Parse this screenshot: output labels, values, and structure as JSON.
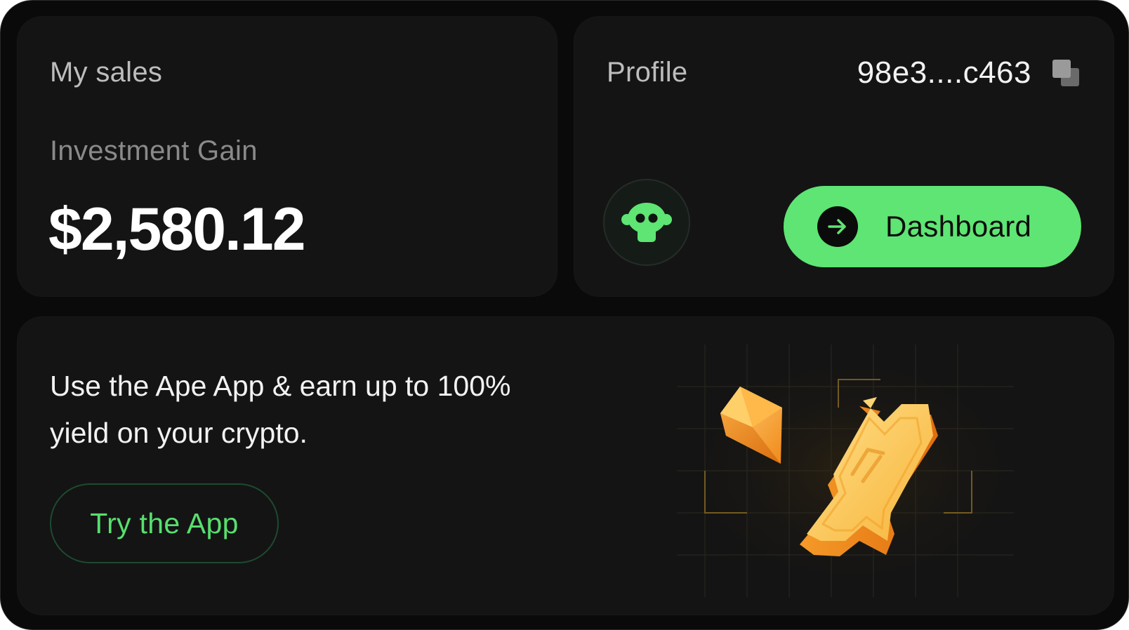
{
  "sales": {
    "title": "My sales",
    "gain_label": "Investment Gain",
    "gain_value": "$2,580.12"
  },
  "profile": {
    "title": "Profile",
    "address": "98e3....c463",
    "copy_icon": "copy-icon",
    "avatar_icon": "ape-avatar-icon",
    "dashboard_label": "Dashboard",
    "dashboard_icon": "arrow-right-icon"
  },
  "promo": {
    "text": "Use the Ape App & earn up to 100% yield on your crypto.",
    "button_label": "Try the App",
    "illustration": "gold-token-gem-illustration"
  },
  "colors": {
    "background": "#0a0a0a",
    "card": "#141414",
    "accent_green": "#5ee573",
    "gold": "#f7b43a",
    "orange": "#f08a1a"
  }
}
